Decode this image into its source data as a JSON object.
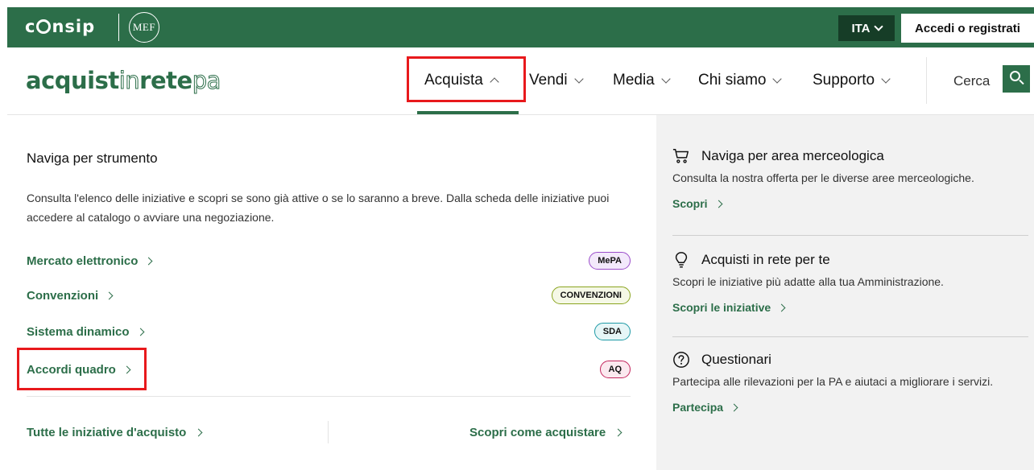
{
  "colors": {
    "brand_green": "#2c6e49",
    "dark_green": "#163d27",
    "highlight_red": "#e8191c",
    "panel_gray": "#f2f2f2"
  },
  "topbar": {
    "consip_logo": "consip",
    "mef_logo": "MEF",
    "language": "ITA",
    "login_label": "Accedi o registrati"
  },
  "navbar": {
    "brand": {
      "part1": "acquist",
      "part2": "in",
      "part3": "rete",
      "part4": "pa"
    },
    "items": [
      {
        "label": "Acquista",
        "expanded": true
      },
      {
        "label": "Vendi"
      },
      {
        "label": "Media"
      },
      {
        "label": "Chi siamo"
      },
      {
        "label": "Supporto"
      }
    ],
    "search_label": "Cerca",
    "search_icon": "search-icon"
  },
  "menu": {
    "title": "Naviga per strumento",
    "intro": "Consulta l'elenco delle iniziative e scopri se sono già attive o se lo saranno a breve. Dalla scheda delle iniziative puoi accedere al catalogo o avviare una negoziazione.",
    "tools": [
      {
        "label": "Mercato elettronico",
        "badge": "MePA",
        "badge_color": "#9b4dca",
        "badge_bg": "#f3e9fb"
      },
      {
        "label": "Convenzioni",
        "badge": "CONVENZIONI",
        "badge_color": "#8aa41f",
        "badge_bg": "#f5f8e6"
      },
      {
        "label": "Sistema dinamico",
        "badge": "SDA",
        "badge_color": "#1e9aa6",
        "badge_bg": "#e6f6f7"
      },
      {
        "label": "Accordi quadro",
        "badge": "AQ",
        "badge_color": "#c3245c",
        "badge_bg": "#fbe9ef"
      }
    ],
    "footer_left": "Tutte le iniziative d'acquisto",
    "footer_right": "Scopri come acquistare"
  },
  "sidebar": {
    "cards": [
      {
        "icon": "cart-icon",
        "title": "Naviga per area merceologica",
        "desc": "Consulta la nostra offerta per le diverse aree merceologiche.",
        "link": "Scopri"
      },
      {
        "icon": "lightbulb-icon",
        "title": "Acquisti in rete per te",
        "desc": "Scopri le iniziative più adatte alla tua Amministrazione.",
        "link": "Scopri le iniziative"
      },
      {
        "icon": "question-icon",
        "title": "Questionari",
        "desc": "Partecipa alle rilevazioni per la PA e aiutaci a migliorare i servizi.",
        "link": "Partecipa"
      }
    ]
  }
}
